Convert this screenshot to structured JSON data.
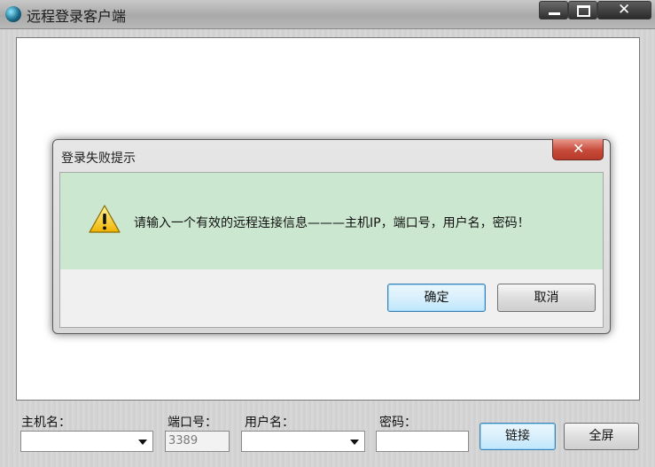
{
  "window": {
    "title": "远程登录客户端",
    "icons": {
      "app": "app-globe-icon",
      "minimize": "minimize-icon",
      "maximize": "maximize-icon",
      "close": "close-icon"
    }
  },
  "dialog": {
    "title": "登录失败提示",
    "message": "请输入一个有效的远程连接信息———主机IP，端口号，用户名，密码！",
    "icon": "warning-icon",
    "ok_label": "确定",
    "cancel_label": "取消",
    "message_bg": "#cce7cf"
  },
  "form": {
    "host_label": "主机名：",
    "host_value": "",
    "port_label": "端口号：",
    "port_value": "3389",
    "user_label": "用户名：",
    "user_value": "",
    "password_label": "密码：",
    "password_value": "",
    "connect_label": "链接",
    "fullscreen_label": "全屏"
  }
}
